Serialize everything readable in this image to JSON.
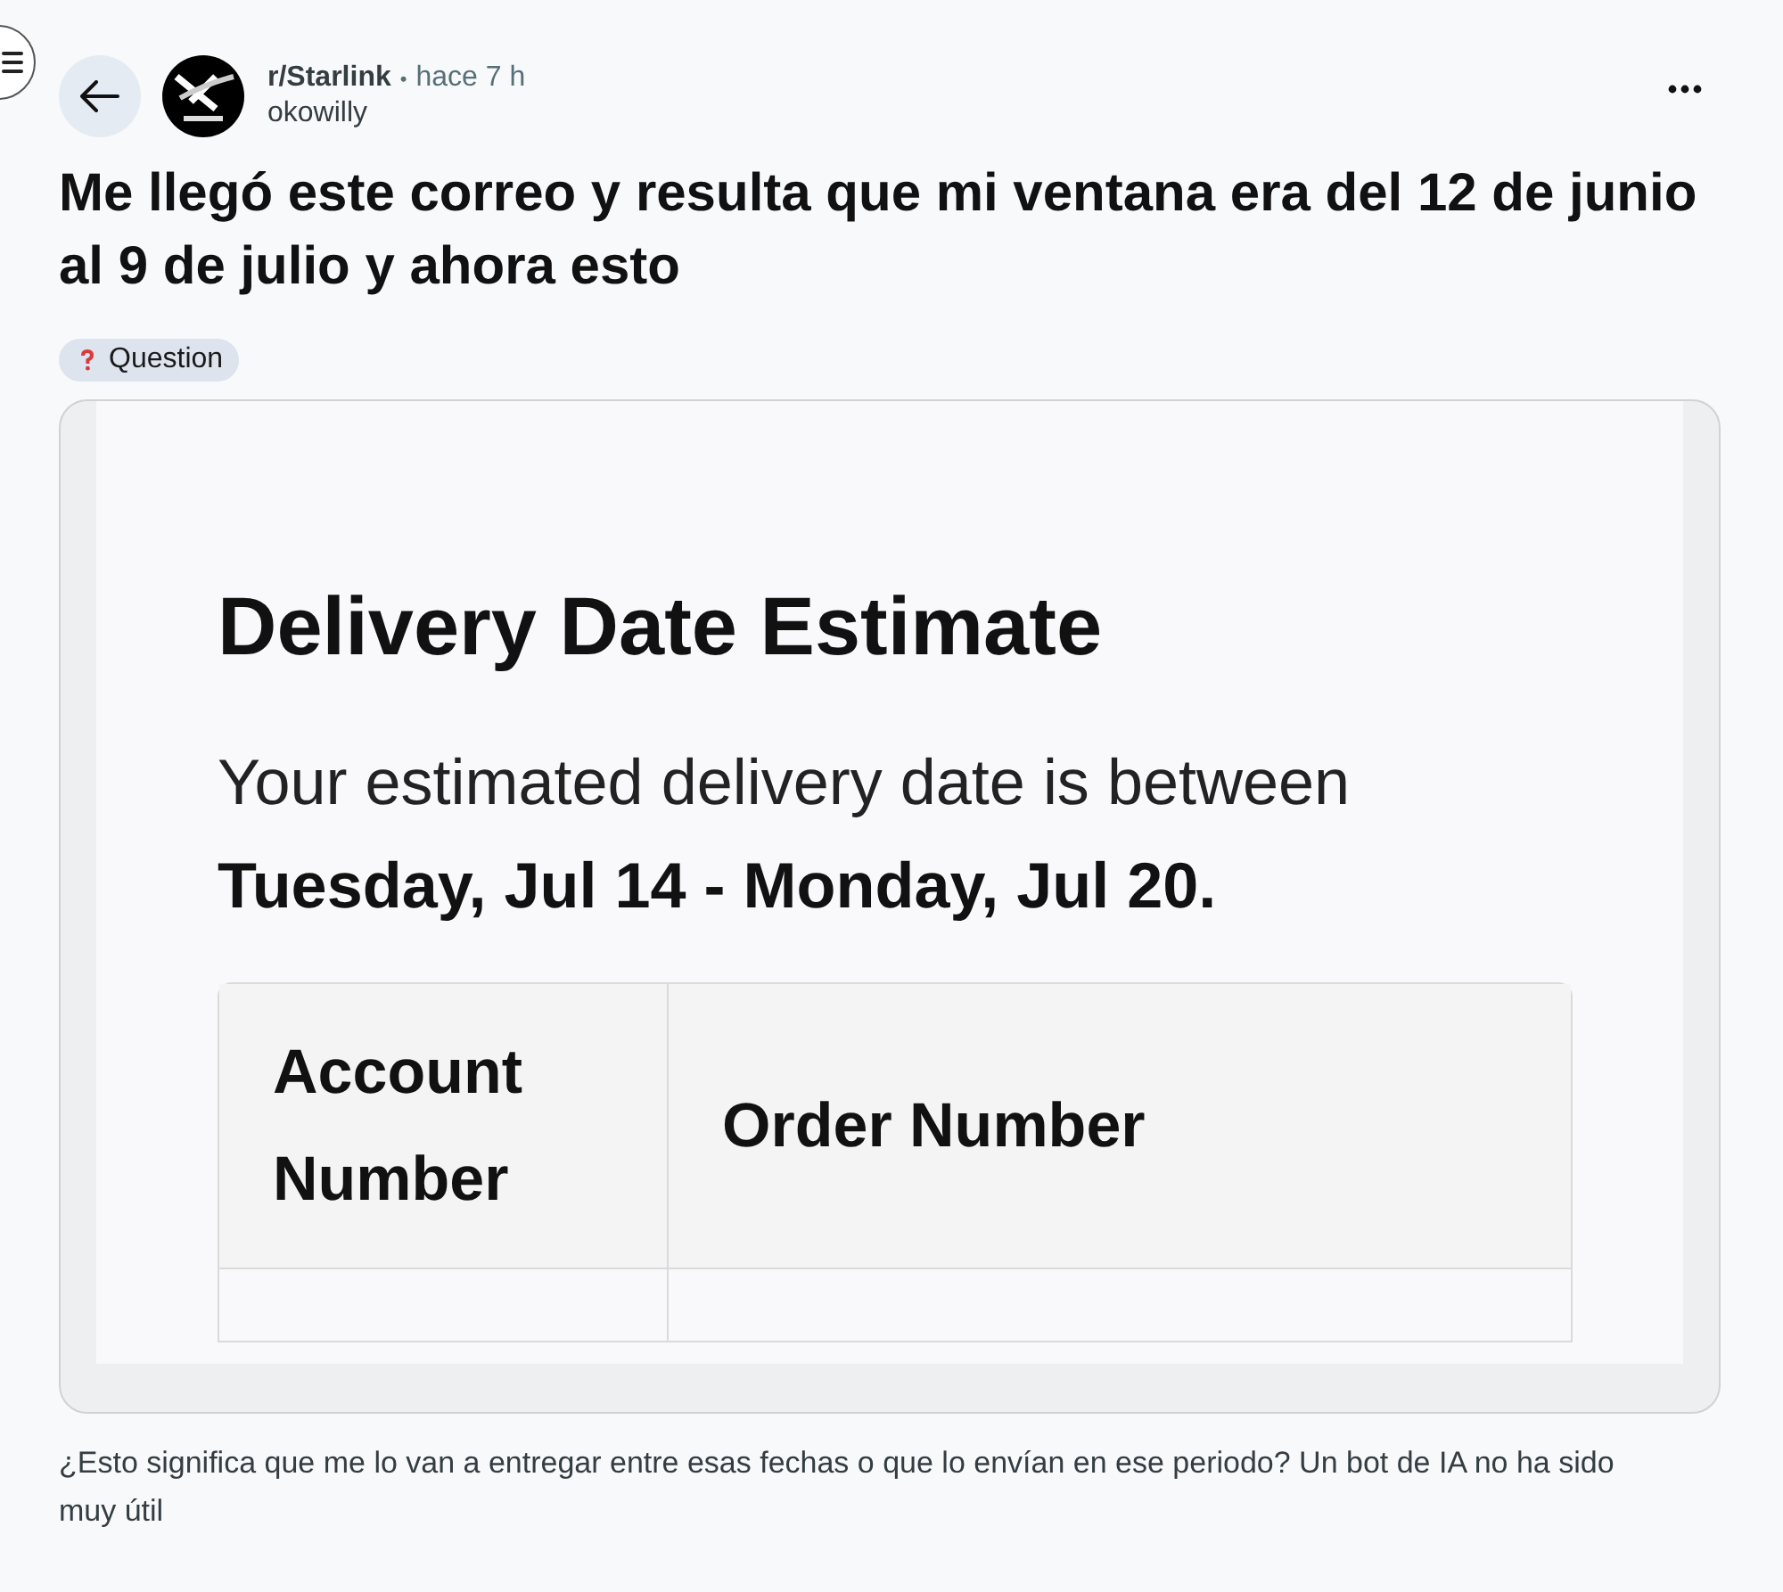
{
  "post": {
    "subreddit": "r/Starlink",
    "separator": "•",
    "time": "hace 7 h",
    "author": "okowilly",
    "title": "Me llegó este correo y resulta que mi ventana era del 12 de junio al 9 de julio y ahora esto",
    "flair": "Question",
    "body": "¿Esto significa que me lo van a entregar entre esas fechas o que lo envían en ese periodo? Un bot de IA no ha sido muy útil"
  },
  "email": {
    "heading": "Delivery Date Estimate",
    "intro": "Your estimated delivery date is between",
    "dates": "Tuesday, Jul 14 - Monday, Jul 20.",
    "table": {
      "columns": [
        "Account Number",
        "Order Number"
      ]
    }
  }
}
